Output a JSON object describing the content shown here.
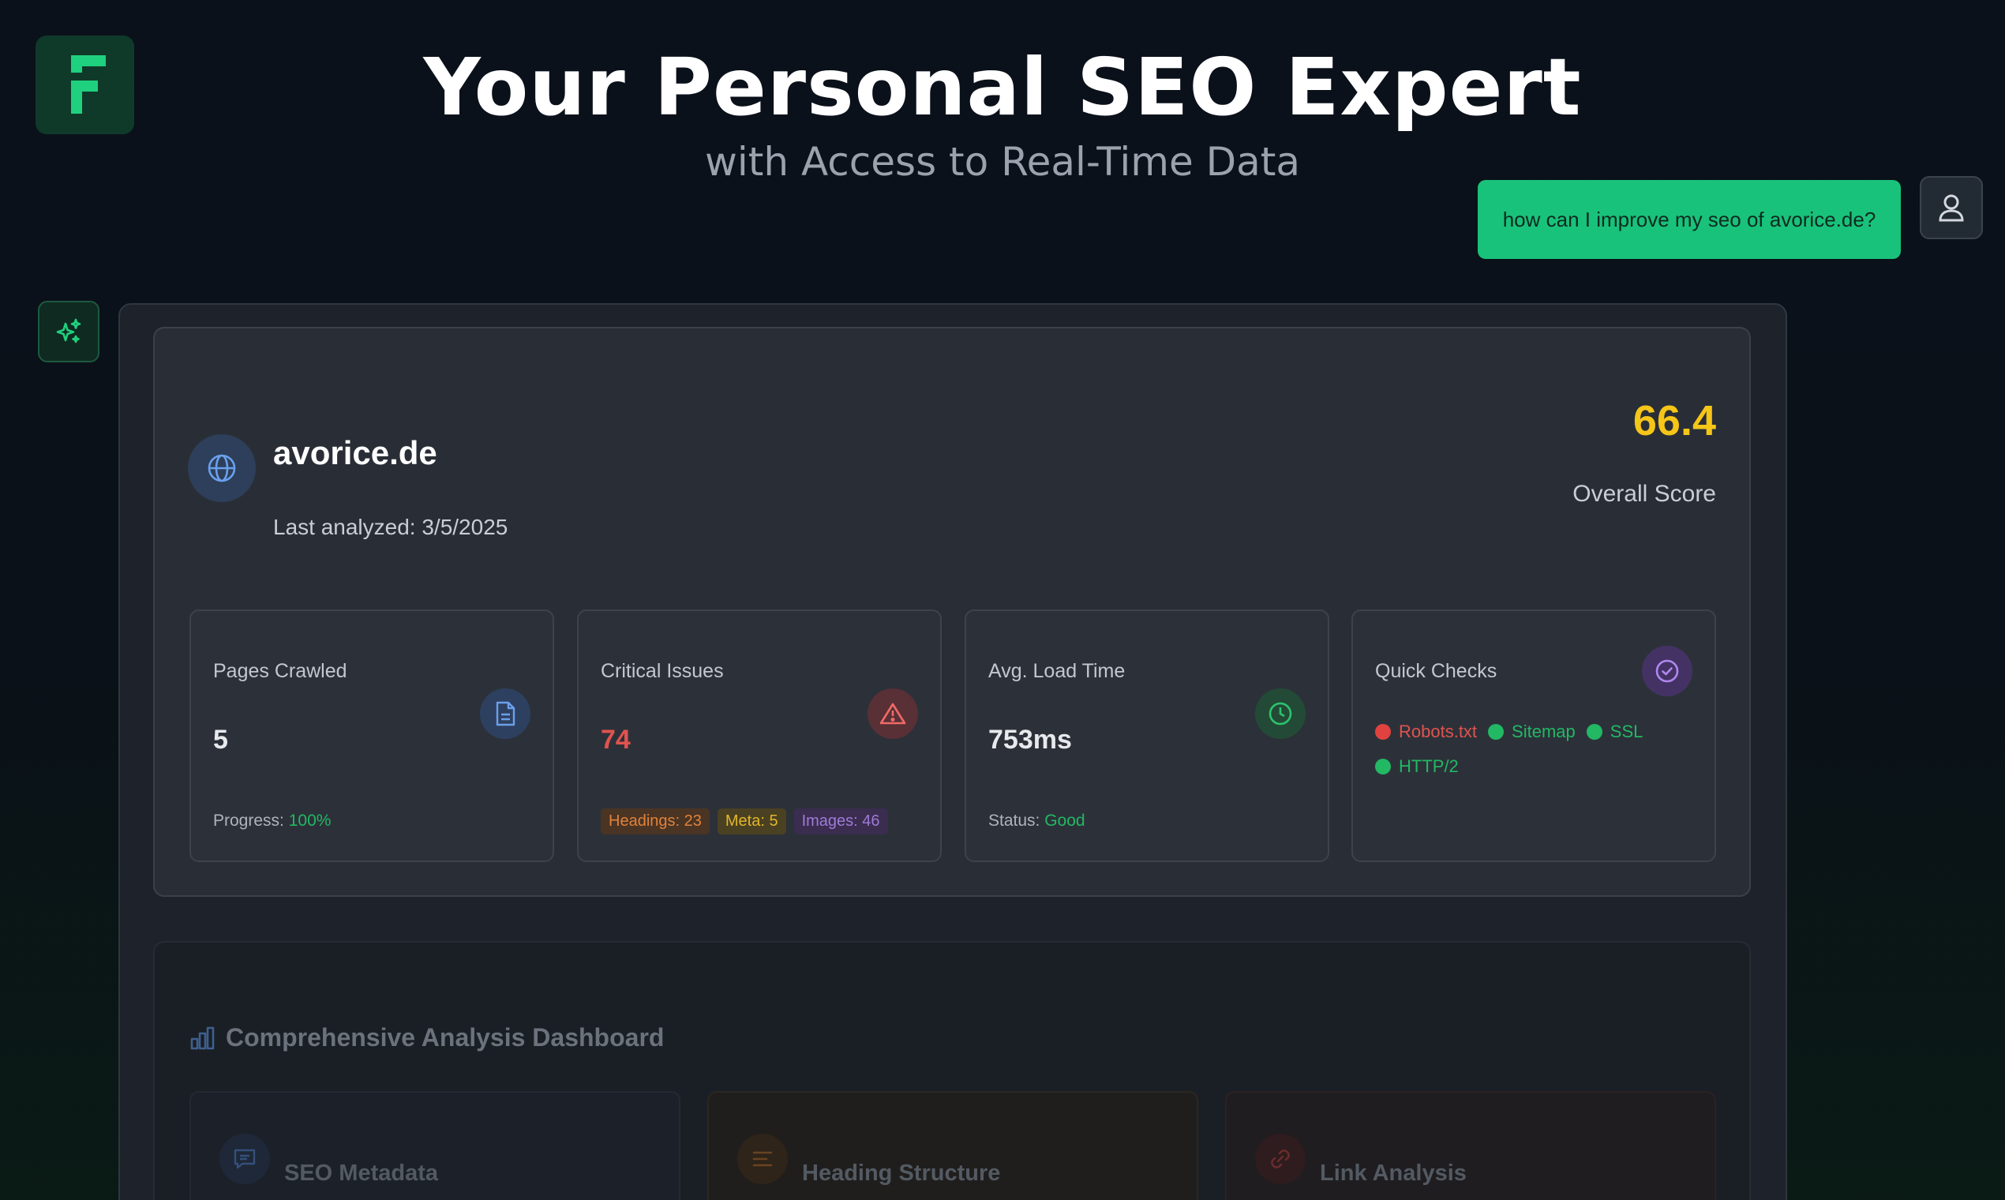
{
  "header": {
    "title": "Your Personal SEO Expert",
    "subtitle": "with Access to Real-Time Data",
    "logo_icon": "brand-f-logo-icon"
  },
  "chat": {
    "user_message": "how can I improve my seo of avorice.de?",
    "user_icon": "user-icon",
    "assistant_icon": "sparkles-icon"
  },
  "summary": {
    "domain": "avorice.de",
    "last_analyzed": "Last analyzed: 3/5/2025",
    "score": "66.4",
    "score_label": "Overall Score",
    "score_color": "#f5c518"
  },
  "stats": {
    "pages": {
      "title": "Pages Crawled",
      "value": "5",
      "foot_label": "Progress:",
      "foot_value": "100%",
      "icon": "document-icon"
    },
    "issues": {
      "title": "Critical Issues",
      "value": "74",
      "icon": "warning-triangle-icon",
      "tags": {
        "headings": "Headings: 23",
        "meta": "Meta: 5",
        "images": "Images: 46"
      }
    },
    "load": {
      "title": "Avg. Load Time",
      "value": "753ms",
      "foot_label": "Status:",
      "foot_value": "Good",
      "icon": "clock-icon"
    },
    "checks": {
      "title": "Quick Checks",
      "icon": "check-circle-icon",
      "items": {
        "robots": "Robots.txt",
        "sitemap": "Sitemap",
        "ssl": "SSL",
        "http2": "HTTP/2"
      },
      "status_colors": {
        "fail": "#e0433f",
        "pass": "#22b864"
      }
    }
  },
  "dashboard": {
    "title": "Comprehensive Analysis Dashboard",
    "cards": {
      "metadata": "SEO Metadata",
      "headings": "Heading Structure",
      "links": "Link Analysis"
    }
  }
}
